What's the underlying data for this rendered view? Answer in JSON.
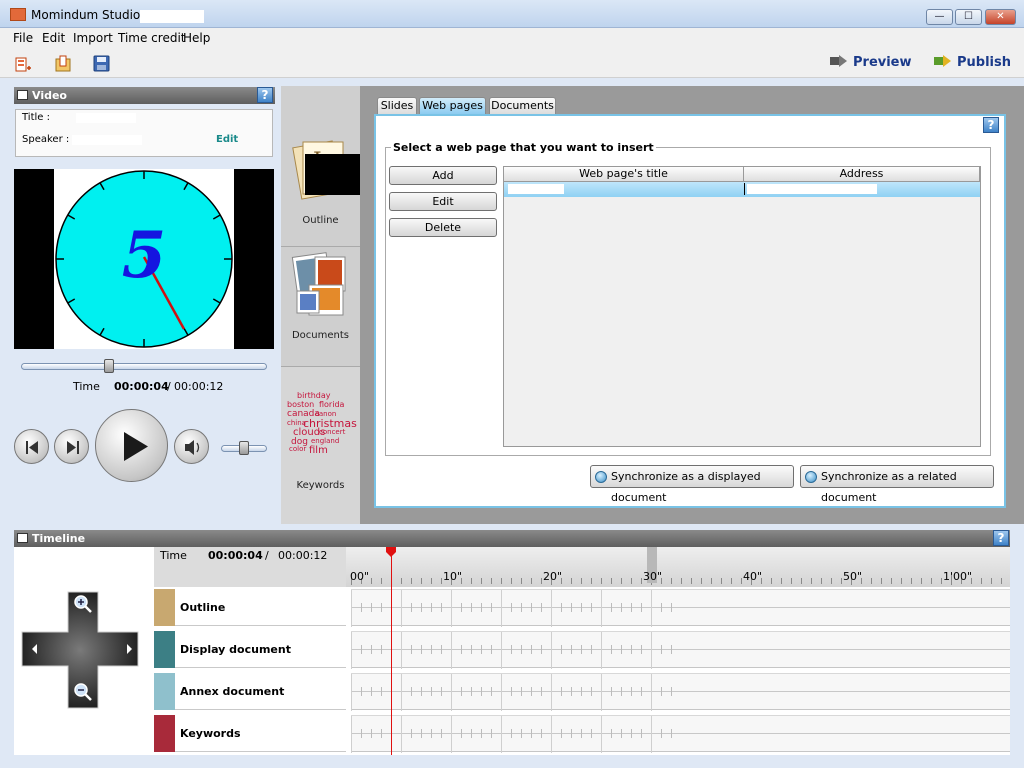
{
  "window": {
    "title": "Momindum Studio -",
    "min": "—",
    "max": "☐",
    "close": "✕"
  },
  "menu": {
    "file": "File",
    "edit": "Edit",
    "import": "Import",
    "time_credit": "Time credit",
    "help": "Help"
  },
  "toolbar": {
    "preview": "Preview",
    "publish": "Publish"
  },
  "video": {
    "header": "Video",
    "help": "?",
    "title_label": "Title :",
    "speaker_label": "Speaker :",
    "edit_link": "Edit",
    "clock_digit": "5",
    "time_label": "Time",
    "current_time": "00:00:04",
    "separator": "/",
    "total_time": "00:00:12",
    "seek_fraction": 0.35,
    "volume_fraction": 0.5
  },
  "sidebar": {
    "outline": "Outline",
    "documents": "Documents",
    "keywords": "Keywords",
    "cloud_words": [
      {
        "text": "birthday"
      },
      {
        "text": "boston"
      },
      {
        "text": "florida"
      },
      {
        "text": "canada"
      },
      {
        "text": "canon"
      },
      {
        "text": "china"
      },
      {
        "text": "christmas"
      },
      {
        "text": "clouds"
      },
      {
        "text": "concert"
      },
      {
        "text": "dog"
      },
      {
        "text": "england"
      },
      {
        "text": "color"
      },
      {
        "text": "film"
      }
    ]
  },
  "tabs": {
    "slides": "Slides",
    "web_pages": "Web pages",
    "documents": "Documents"
  },
  "webpages": {
    "help": "?",
    "group_title": "Select a web page that you want to insert",
    "add": "Add",
    "edit": "Edit",
    "delete": "Delete",
    "col_title": "Web page's title",
    "col_address": "Address",
    "sync_displayed": "Synchronize as a displayed document",
    "sync_related": "Synchronize as a related document"
  },
  "timeline": {
    "header": "Timeline",
    "help": "?",
    "time_label": "Time",
    "current_time": "00:00:04",
    "separator": "/",
    "total_time": "00:00:12",
    "ticks": [
      "00\"",
      "10\"",
      "20\"",
      "30\"",
      "40\"",
      "50\"",
      "1'00\""
    ],
    "playhead_seconds": 4,
    "tracks": [
      {
        "name": "Outline",
        "color": "#c8a870"
      },
      {
        "name": "Display document",
        "color": "#3c7f85"
      },
      {
        "name": "Annex document",
        "color": "#8fc0cc"
      },
      {
        "name": "Keywords",
        "color": "#a82a3a"
      }
    ]
  }
}
